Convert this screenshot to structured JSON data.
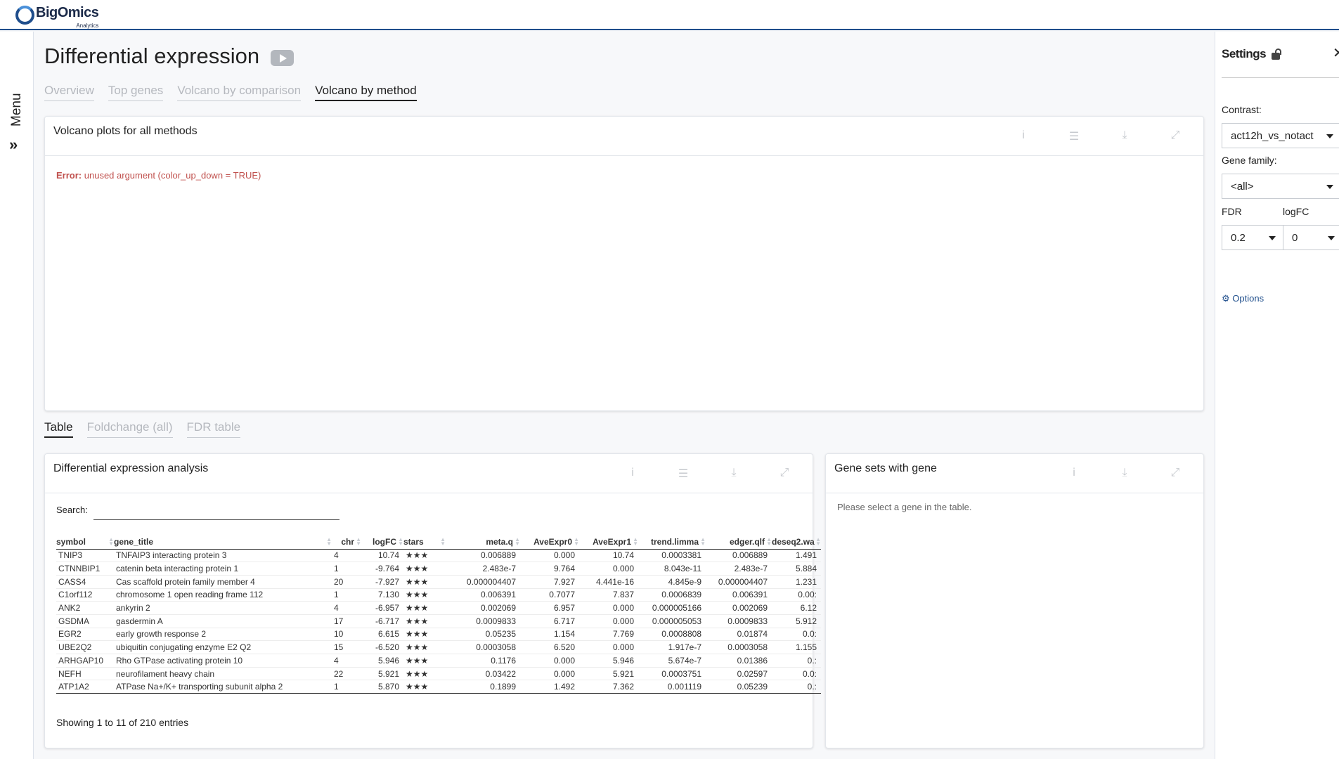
{
  "app": {
    "logo_text": "BigOmics",
    "logo_subtext": "Analytics",
    "menu_label": "Menu",
    "menu_chevron": "»"
  },
  "page": {
    "title": "Differential expression",
    "tabs": [
      "Overview",
      "Top genes",
      "Volcano by comparison",
      "Volcano by method"
    ],
    "active_tab": "Volcano by method"
  },
  "volcano_card": {
    "title": "Volcano plots for all methods",
    "error_label": "Error:",
    "error_message": "unused argument (color_up_down = TRUE)",
    "icons": [
      "info-icon",
      "menu-icon",
      "download-icon",
      "expand-icon"
    ]
  },
  "bottom_tabs": [
    "Table",
    "Foldchange (all)",
    "FDR table"
  ],
  "dea_card": {
    "title": "Differential expression analysis",
    "search_label": "Search:",
    "search_value": "",
    "columns": [
      "symbol",
      "gene_title",
      "chr",
      "logFC",
      "stars",
      "meta.q",
      "AveExpr0",
      "AveExpr1",
      "trend.limma",
      "edger.qlf",
      "deseq2.wa"
    ],
    "rows": [
      [
        "TNIP3",
        "TNFAIP3 interacting protein 3",
        "4",
        "10.74",
        "★★★",
        "0.006889",
        "0.000",
        "10.74",
        "0.0003381",
        "0.006889",
        "1.491"
      ],
      [
        "CTNNBIP1",
        "catenin beta interacting protein 1",
        "1",
        "-9.764",
        "★★★",
        "2.483e-7",
        "9.764",
        "0.000",
        "8.043e-11",
        "2.483e-7",
        "5.884"
      ],
      [
        "CASS4",
        "Cas scaffold protein family member 4",
        "20",
        "-7.927",
        "★★★",
        "0.000004407",
        "7.927",
        "4.441e-16",
        "4.845e-9",
        "0.000004407",
        "1.231"
      ],
      [
        "C1orf112",
        "chromosome 1 open reading frame 112",
        "1",
        "7.130",
        "★★★",
        "0.006391",
        "0.7077",
        "7.837",
        "0.0006839",
        "0.006391",
        "0.00:"
      ],
      [
        "ANK2",
        "ankyrin 2",
        "4",
        "-6.957",
        "★★★",
        "0.002069",
        "6.957",
        "0.000",
        "0.000005166",
        "0.002069",
        "6.12"
      ],
      [
        "GSDMA",
        "gasdermin A",
        "17",
        "-6.717",
        "★★★",
        "0.0009833",
        "6.717",
        "0.000",
        "0.000005053",
        "0.0009833",
        "5.912"
      ],
      [
        "EGR2",
        "early growth response 2",
        "10",
        "6.615",
        "★★★",
        "0.05235",
        "1.154",
        "7.769",
        "0.0008808",
        "0.01874",
        "0.0:"
      ],
      [
        "UBE2Q2",
        "ubiquitin conjugating enzyme E2 Q2",
        "15",
        "-6.520",
        "★★★",
        "0.0003058",
        "6.520",
        "0.000",
        "1.917e-7",
        "0.0003058",
        "1.155"
      ],
      [
        "ARHGAP10",
        "Rho GTPase activating protein 10",
        "4",
        "5.946",
        "★★★",
        "0.1176",
        "0.000",
        "5.946",
        "5.674e-7",
        "0.01386",
        "0.:"
      ],
      [
        "NEFH",
        "neurofilament heavy chain",
        "22",
        "5.921",
        "★★★",
        "0.03422",
        "0.000",
        "5.921",
        "0.0003751",
        "0.02597",
        "0.0:"
      ],
      [
        "ATP1A2",
        "ATPase Na+/K+ transporting subunit alpha 2",
        "1",
        "5.870",
        "★★★",
        "0.1899",
        "1.492",
        "7.362",
        "0.001119",
        "0.05239",
        "0.:"
      ]
    ],
    "showing": "Showing 1 to 11 of 210 entries"
  },
  "gs_card": {
    "title": "Gene sets with gene",
    "message": "Please select a gene in the table."
  },
  "settings": {
    "title": "Settings",
    "close": "✕",
    "contrast_label": "Contrast:",
    "contrast_value": "act12h_vs_notact",
    "gene_family_label": "Gene family:",
    "gene_family_value": "<all>",
    "fdr_label": "FDR",
    "fdr_value": "0.2",
    "logfc_label": "logFC",
    "logfc_value": "0",
    "options_label": "Options"
  }
}
